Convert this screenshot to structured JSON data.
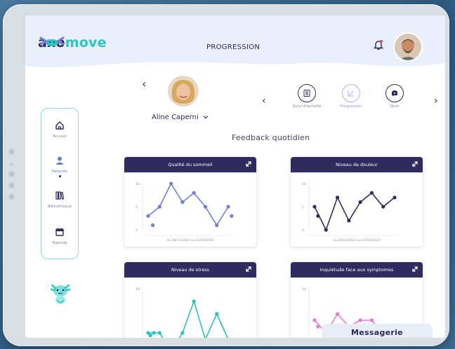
{
  "app": {
    "logo_text_part1": "axo",
    "logo_text_part2": "move",
    "page_title": "PROGRESSION",
    "accent": "#2cc5c0",
    "brand_dark": "#2f2b5f"
  },
  "sidebar": {
    "items": [
      {
        "label": "Accueil",
        "icon": "home-icon",
        "active": false
      },
      {
        "label": "Patients",
        "icon": "user-icon",
        "active": true
      },
      {
        "label": "Bibliothèque",
        "icon": "books-icon",
        "active": false
      },
      {
        "label": "Agenda",
        "icon": "calendar-icon",
        "active": false
      }
    ]
  },
  "patient": {
    "name": "Aline Caperni",
    "dropdown_icon": "chevron-down-icon"
  },
  "tabs": [
    {
      "label": "Suivi d'activité",
      "icon": "checklist-icon",
      "active": false
    },
    {
      "label": "Progression",
      "icon": "chart-line-icon",
      "active": true
    },
    {
      "label": "Quiz",
      "icon": "quiz-icon",
      "active": false
    }
  ],
  "section_title": "Feedback quotidien",
  "messagerie_label": "Messagerie",
  "chart_data": [
    {
      "type": "line",
      "title": "Qualité du sommeil",
      "period": "du 28/11/2022 au 21/02/2023",
      "yticks": [
        "0",
        "5",
        "10"
      ],
      "ylim": [
        0,
        10
      ],
      "color": "#6e7fd6",
      "x": [
        0,
        1,
        2,
        3,
        4,
        5,
        6,
        7
      ],
      "values": [
        3,
        5,
        10,
        6,
        8,
        5,
        1,
        5
      ],
      "extra_points": [
        [
          0.4,
          1
        ],
        [
          7.3,
          3
        ]
      ]
    },
    {
      "type": "line",
      "title": "Niveau de douleur",
      "period": "du 28/11/2022 au 21/02/2023",
      "yticks": [
        "0",
        "5",
        "10"
      ],
      "ylim": [
        0,
        10
      ],
      "color": "#2f2b5f",
      "x": [
        0,
        1,
        2,
        3,
        4,
        5,
        6,
        7
      ],
      "values": [
        5,
        0,
        7,
        2,
        6,
        8,
        5,
        7
      ],
      "extra_points": [
        [
          0.3,
          3
        ]
      ]
    },
    {
      "type": "line",
      "title": "Niveau de stress",
      "yticks": [
        "10"
      ],
      "ylim": [
        0,
        10
      ],
      "color": "#2bc2bd",
      "x": [
        0,
        1,
        2,
        3,
        4,
        5,
        6,
        7
      ],
      "values": [
        3,
        3,
        0,
        3,
        8,
        2,
        6,
        2
      ],
      "extra_points": [
        [
          0.2,
          2.6
        ],
        [
          0.5,
          3
        ]
      ]
    },
    {
      "type": "line",
      "title": "Inquiétude face aux symptomes",
      "yticks": [
        "10"
      ],
      "ylim": [
        0,
        10
      ],
      "color": "#e07dd0",
      "x": [
        0,
        1,
        2,
        3,
        4,
        5,
        6,
        7
      ],
      "values": [
        5,
        3,
        6,
        4,
        5,
        5,
        3,
        4
      ],
      "extra_points": [
        [
          0.3,
          4
        ]
      ]
    }
  ]
}
